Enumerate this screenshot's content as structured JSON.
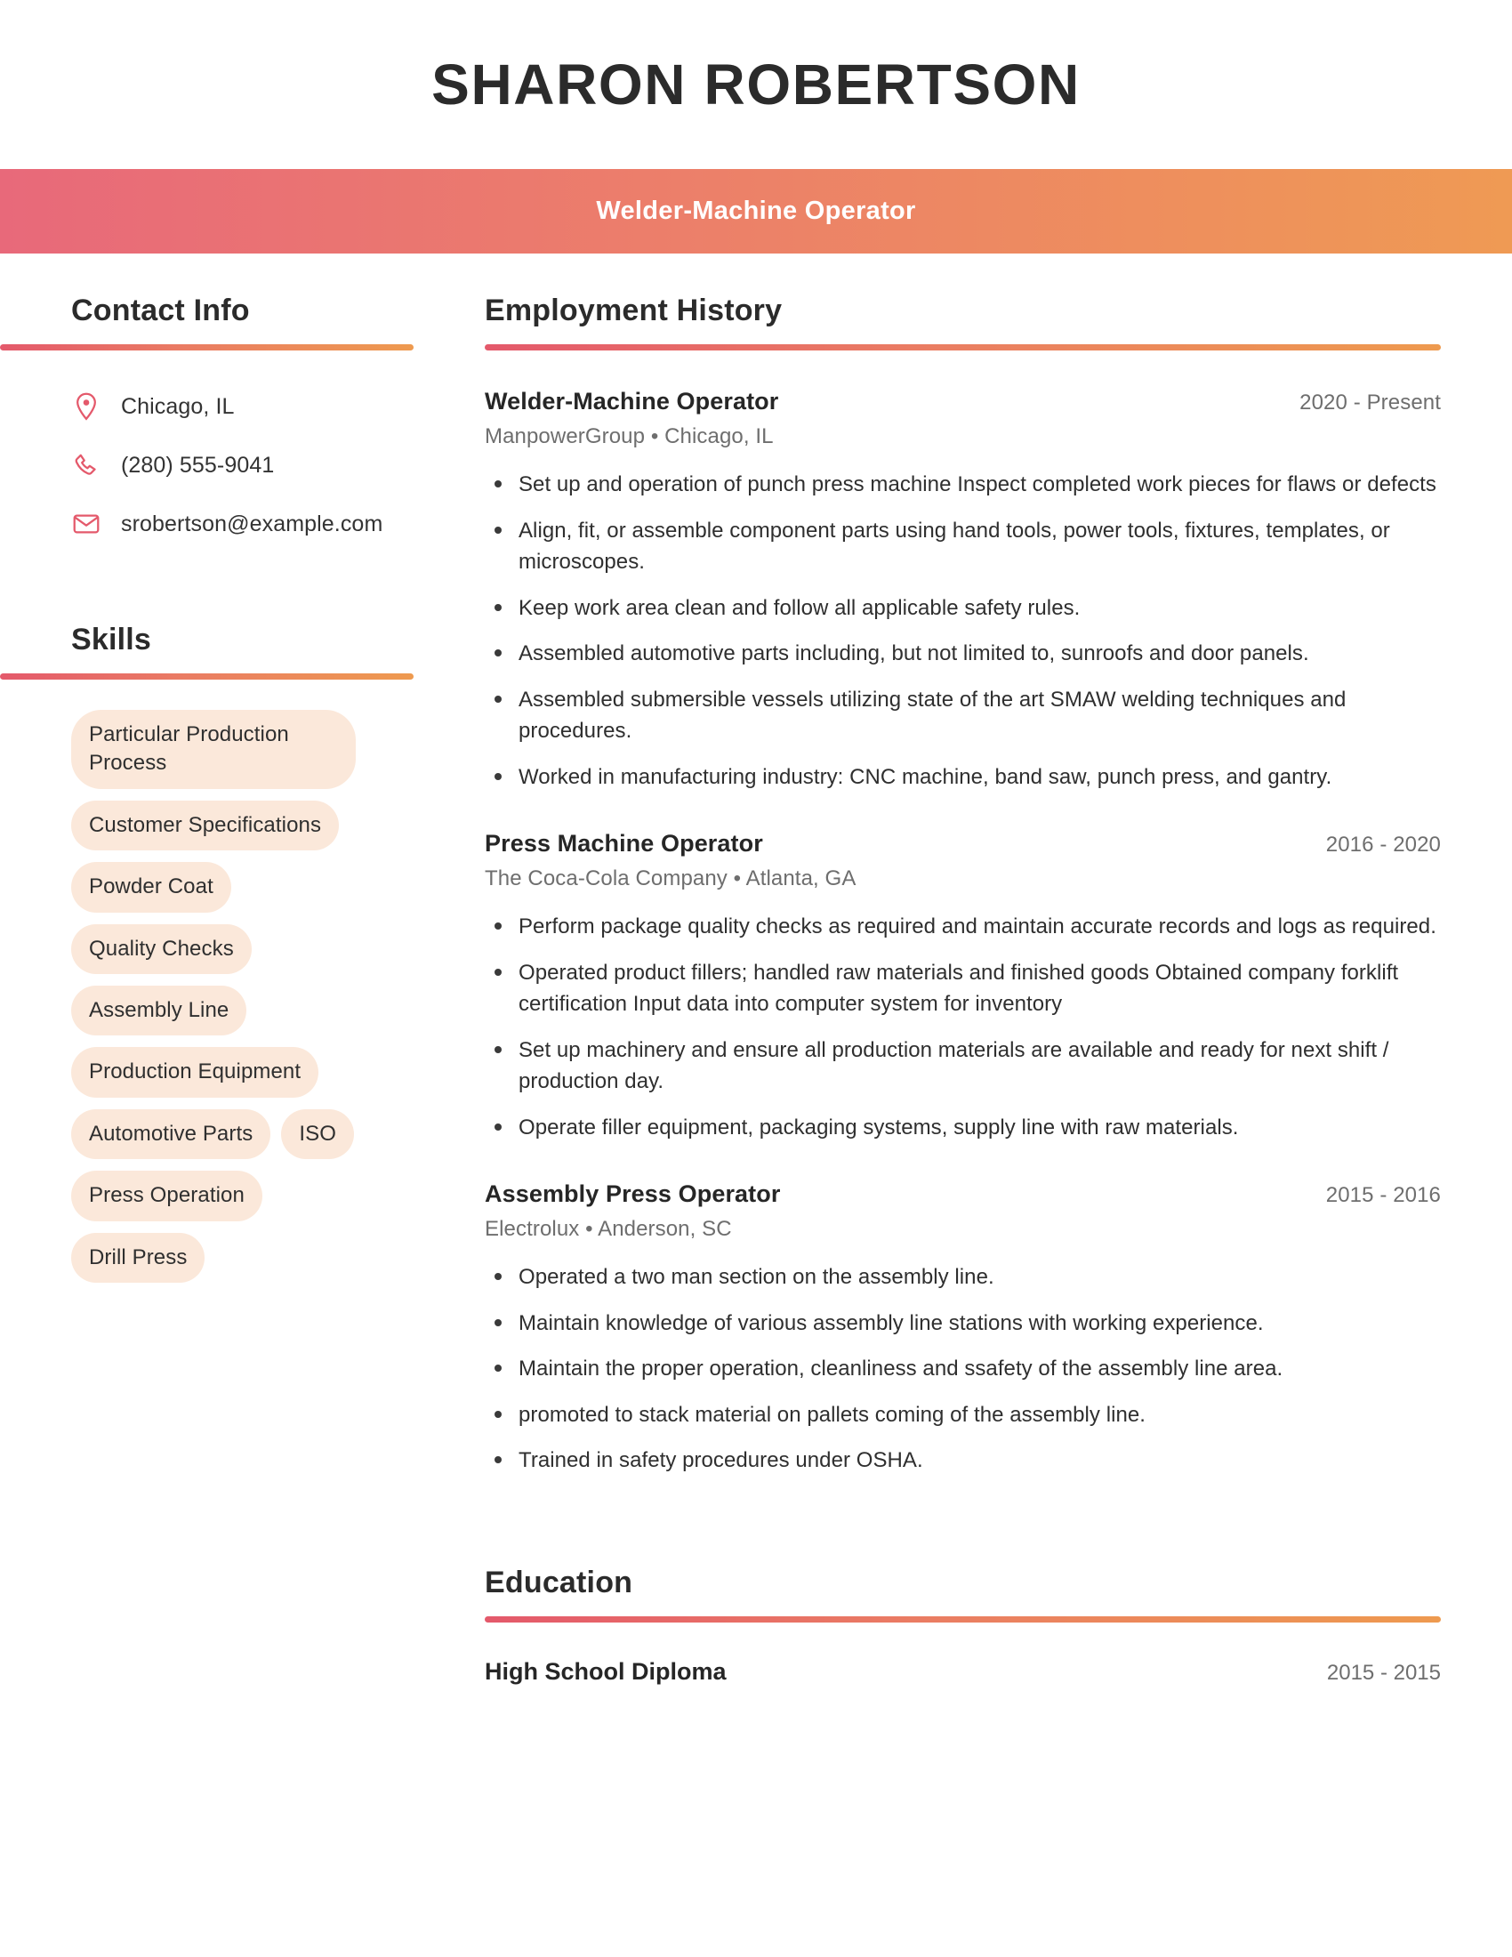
{
  "header": {
    "name": "SHARON ROBERTSON",
    "title": "Welder-Machine Operator",
    "band_gradient_start": "#e8697a",
    "band_gradient_end": "#ef9a54"
  },
  "sidebar": {
    "contact": {
      "heading": "Contact Info",
      "items": [
        {
          "icon": "location-pin-icon",
          "value": "Chicago, IL"
        },
        {
          "icon": "phone-icon",
          "value": "(280) 555-9041"
        },
        {
          "icon": "envelope-icon",
          "value": "srobertson@example.com"
        }
      ]
    },
    "skills": {
      "heading": "Skills",
      "pill_bg": "#fbe8da",
      "items": [
        "Particular Production Process",
        "Customer Specifications",
        "Powder Coat",
        "Quality Checks",
        "Assembly Line",
        "Production Equipment",
        "Automotive Parts",
        "ISO",
        "Press Operation",
        "Drill Press"
      ]
    }
  },
  "main": {
    "employment": {
      "heading": "Employment History",
      "jobs": [
        {
          "title": "Welder-Machine Operator",
          "dates": "2020 - Present",
          "subtitle": "ManpowerGroup  •  Chicago, IL",
          "bullets": [
            "Set up and operation of punch press machine Inspect completed work pieces for flaws or defects",
            "Align, fit, or assemble component parts using hand tools, power tools, fixtures, templates, or microscopes.",
            "Keep work area clean and follow all applicable safety rules.",
            "Assembled automotive parts including, but not limited to, sunroofs and door panels.",
            "Assembled submersible vessels utilizing state of the art SMAW welding techniques and procedures.",
            "Worked in manufacturing industry: CNC machine, band saw, punch press, and gantry."
          ]
        },
        {
          "title": "Press Machine Operator",
          "dates": "2016 - 2020",
          "subtitle": "The Coca-Cola Company  •  Atlanta, GA",
          "bullets": [
            "Perform package quality checks as required and maintain accurate records and logs as required.",
            "Operated product fillers; handled raw materials and finished goods Obtained company forklift certification Input data into computer system for inventory",
            "Set up machinery and ensure all production materials are available and ready for next shift / production day.",
            "Operate filler equipment, packaging systems, supply line with raw materials."
          ]
        },
        {
          "title": "Assembly Press Operator",
          "dates": "2015 - 2016",
          "subtitle": "Electrolux  •  Anderson, SC",
          "bullets": [
            "Operated a two man section on the assembly line.",
            "Maintain knowledge of various assembly line stations with working experience.",
            "Maintain the proper operation, cleanliness and ssafety of the assembly line area.",
            "promoted to stack material on pallets coming of the assembly line.",
            "Trained in safety procedures under OSHA."
          ]
        }
      ]
    },
    "education": {
      "heading": "Education",
      "entries": [
        {
          "degree": "High School Diploma",
          "dates": "2015 - 2015"
        }
      ]
    }
  }
}
